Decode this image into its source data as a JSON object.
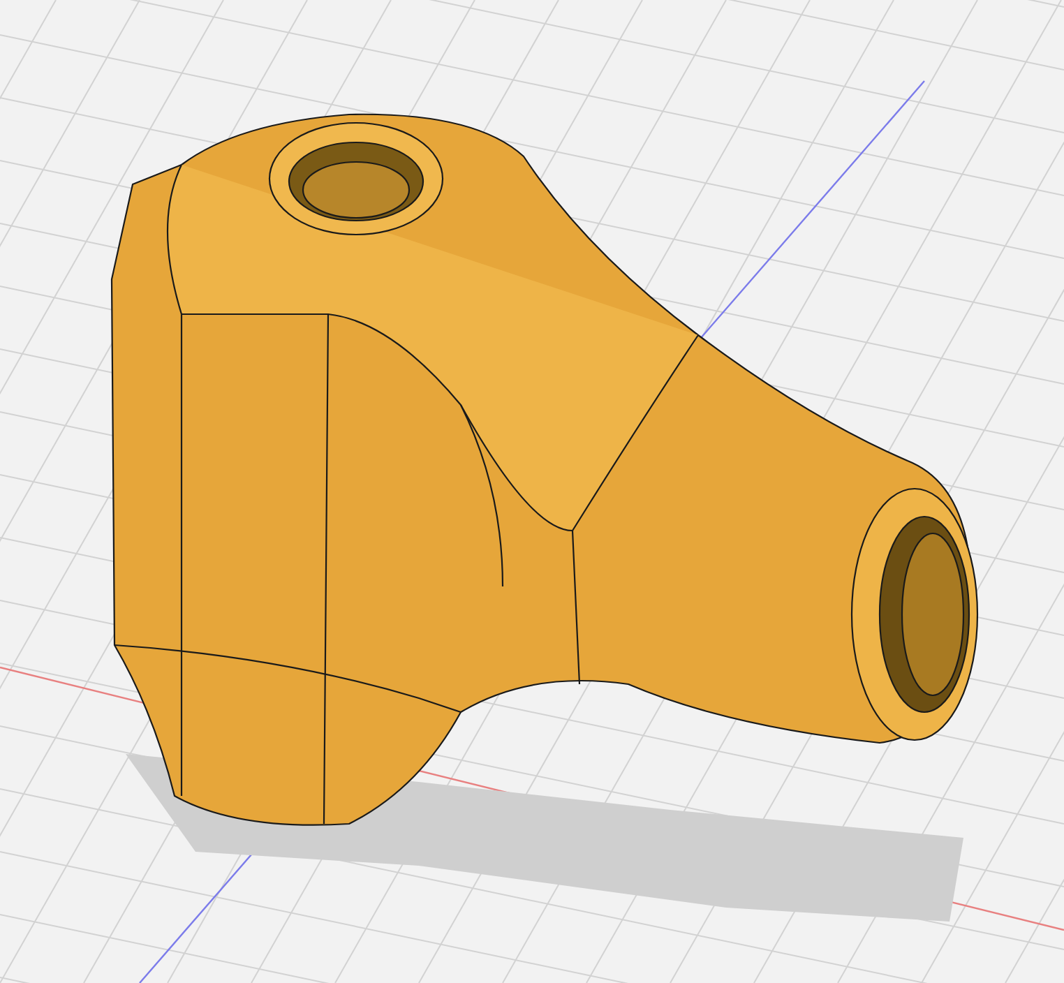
{
  "viewport": {
    "show_grid": true,
    "show_axes": true,
    "show_shadow": true
  }
}
